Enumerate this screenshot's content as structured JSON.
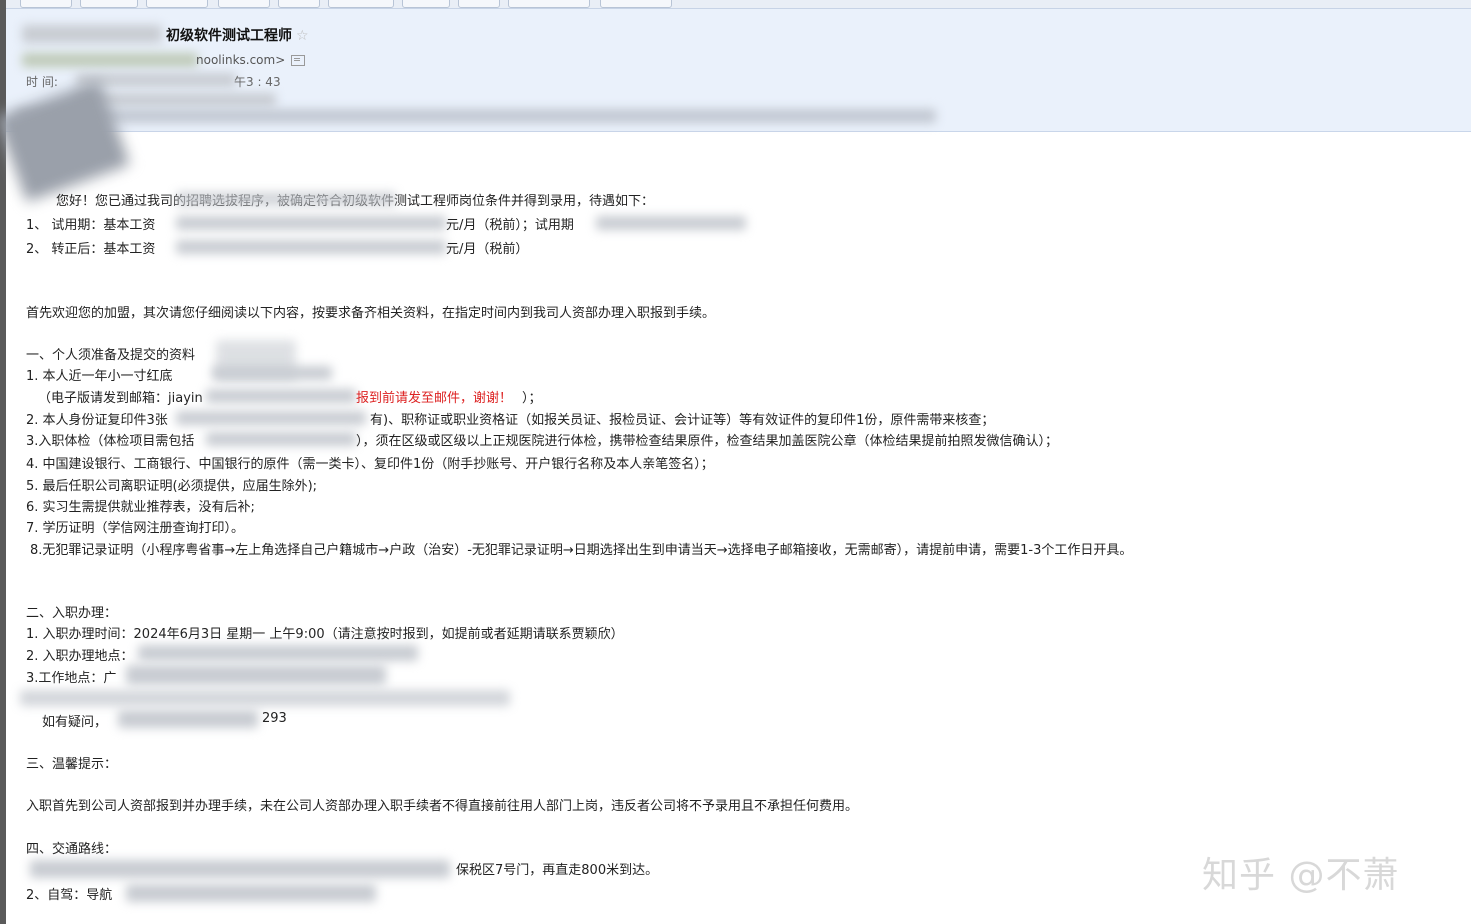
{
  "header": {
    "subject": "初级软件测试工程师",
    "sender_domain": "noolinks.com>",
    "time_label": "时  间:",
    "time_value": "午3 : 43"
  },
  "body": {
    "intro": "您好！您已通过我司的招聘选拔程序，被确定符合初级软件测试工程师岗位条件并得到录用，待遇如下：",
    "salary": [
      "1、 试用期：基本工资",
      "元/月（税前）；试用期",
      "2、 转正后：基本工资",
      "元/月（税前）"
    ],
    "welcome": "首先欢迎您的加盟，其次请您仔细阅读以下内容，按要求备齐相关资料，在指定时间内到我司人资部办理入职报到手续。",
    "section1_title": "一、个人须准备及提交的资料",
    "section1_items": {
      "i1": "1. 本人近一年小一寸红底",
      "i1b_prefix": "（电子版请发到邮箱：jiayin",
      "i1b_red": "报到前请发至邮件，谢谢！",
      "i1b_suffix": "）；",
      "i2a": "2. 本人身份证复印件3张",
      "i2b": "有)、职称证或职业资格证（如报关员证、报检员证、会计证等）等有效证件的复印件1份，原件需带来核查；",
      "i3a": "3.入职体检（体检项目需包括",
      "i3b": "），须在区级或区级以上正规医院进行体检，携带检查结果原件，检查结果加盖医院公章（体检结果提前拍照发微信确认）；",
      "i4": "4. 中国建设银行、工商银行、中国银行的原件（需一类卡）、复印件1份（附手抄账号、开户银行名称及本人亲笔签名）；",
      "i5": "5. 最后任职公司离职证明(必须提供，应届生除外);",
      "i6": "6. 实习生需提供就业推荐表，没有后补;",
      "i7": "7. 学历证明（学信网注册查询打印）。",
      "i8": "8.无犯罪记录证明（小程序粤省事→左上角选择自己户籍城市→户政（治安）-无犯罪记录证明→日期选择出生到申请当天→选择电子邮箱接收，无需邮寄），请提前申请，需要1-3个工作日开具。"
    },
    "section2_title": "二、入职办理：",
    "section2_items": {
      "i1": "1. 入职办理时间：2024年6月3日  星期一  上午9:00（请注意按时报到，如提前或者延期请联系贾颖欣）",
      "i2": "2. 入职办理地点：",
      "i3": "3.工作地点：广",
      "contact": "如有疑问，",
      "contact_tail": "293"
    },
    "section3_title": "三、温馨提示：",
    "section3_text": "入职首先到公司人资部报到并办理手续，未在公司人资部办理入职手续者不得直接前往用人部门上岗，违反者公司将不予录用且不承担任何费用。",
    "section4_title": "四、交通路线：",
    "section4_items": {
      "i1_tail": "保税区7号门，再直走800米到达。",
      "i2": "2、自驾：导航"
    }
  },
  "watermark": "知乎 @不萧",
  "colors": {
    "header_bg": "#eaf1fb",
    "red_text": "#dd2222"
  }
}
